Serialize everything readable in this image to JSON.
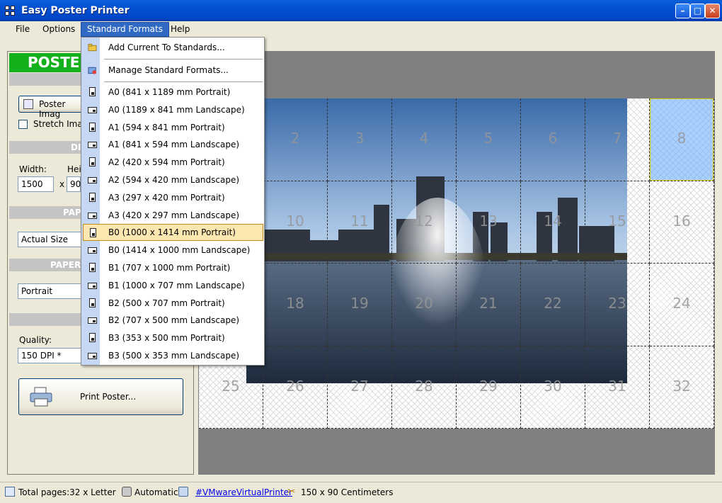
{
  "window": {
    "title": "Easy Poster Printer"
  },
  "menubar": {
    "items": [
      "File",
      "Options",
      "Standard Formats",
      "Help"
    ]
  },
  "left_panel": {
    "header": "POSTE",
    "poster_image_button": "Poster Imag",
    "stretch_label": "Stretch Imag",
    "dimensions_band": "DI",
    "width_label": "Width:",
    "height_label": "Hei",
    "width_value": "1500",
    "times": "x",
    "height_value": "90",
    "paper_band": "PAP",
    "size_value": "Actual Size",
    "orientation_band": "PAPER",
    "orientation_value": "Portrait",
    "quality_label": "Quality:",
    "quality_value": "150 DPI *",
    "print_button": "Print Poster..."
  },
  "dropdown": {
    "actions": [
      "Add Current To Standards...",
      "Manage Standard Formats..."
    ],
    "formats": [
      {
        "label": "A0 (841 x 1189 mm Portrait)",
        "orient": "portrait"
      },
      {
        "label": "A0 (1189 x 841 mm Landscape)",
        "orient": "landscape"
      },
      {
        "label": "A1 (594 x 841 mm Portrait)",
        "orient": "portrait"
      },
      {
        "label": "A1 (841 x 594 mm Landscape)",
        "orient": "landscape"
      },
      {
        "label": "A2 (420 x 594 mm Portrait)",
        "orient": "portrait"
      },
      {
        "label": "A2 (594 x 420 mm Landscape)",
        "orient": "landscape"
      },
      {
        "label": "A3 (297 x 420 mm Portrait)",
        "orient": "portrait"
      },
      {
        "label": "A3 (420 x 297 mm Landscape)",
        "orient": "landscape"
      },
      {
        "label": "B0 (1000 x 1414 mm Portrait)",
        "orient": "portrait",
        "highlighted": true
      },
      {
        "label": "B0 (1414 x 1000 mm Landscape)",
        "orient": "landscape"
      },
      {
        "label": "B1 (707 x 1000 mm Portrait)",
        "orient": "portrait"
      },
      {
        "label": "B1 (1000 x 707 mm Landscape)",
        "orient": "landscape"
      },
      {
        "label": "B2 (500 x 707 mm Portrait)",
        "orient": "portrait"
      },
      {
        "label": "B2 (707 x 500 mm Landscape)",
        "orient": "landscape"
      },
      {
        "label": "B3 (353 x 500 mm Portrait)",
        "orient": "portrait"
      },
      {
        "label": "B3 (500 x 353 mm Landscape)",
        "orient": "landscape"
      }
    ]
  },
  "preview": {
    "columns": 8,
    "rows": 4,
    "visible_tile_numbers": [
      "2",
      "3",
      "4",
      "5",
      "6",
      "7",
      "8",
      "10",
      "11",
      "12",
      "13",
      "14",
      "15",
      "16",
      "18",
      "19",
      "20",
      "21",
      "22",
      "23",
      "24",
      "25",
      "26",
      "27",
      "28",
      "29",
      "30",
      "31",
      "32"
    ],
    "selected_tile": "8"
  },
  "statusbar": {
    "pages": "Total pages:32 x Letter",
    "mode": "Automatic",
    "printer": "#VMwareVirtualPrinter",
    "size": "150 x 90 Centimeters"
  },
  "colors": {
    "accent": "#316ac5",
    "poster_header": "#14b01c",
    "highlight": "#fde7b0"
  }
}
